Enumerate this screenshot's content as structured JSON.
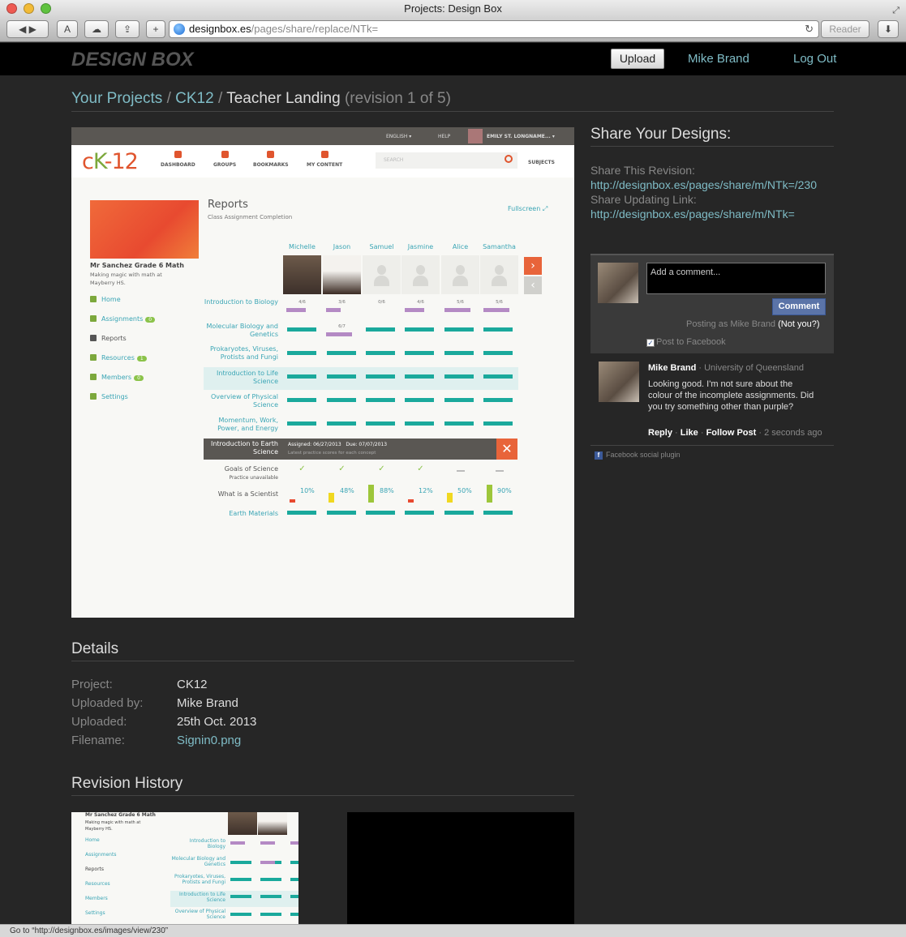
{
  "window": {
    "title": "Projects: Design Box"
  },
  "browser": {
    "url_host": "designbox.es",
    "url_path": "/pages/share/replace/NTk=",
    "reader_label": "Reader",
    "status_text": "Go to “http://designbox.es/images/view/230”"
  },
  "site": {
    "logo": "DESIGN BOX",
    "upload_label": "Upload",
    "user_name": "Mike Brand",
    "logout_label": "Log Out"
  },
  "breadcrumb": {
    "projects": "Your Projects",
    "sep": "/",
    "project": "CK12",
    "page": "Teacher Landing",
    "revision": "(revision 1 of 5)"
  },
  "preview": {
    "topbar": {
      "language": "ENGLISH ▾",
      "help": "HELP",
      "user": "EMILY ST. LONGNAME... ▾"
    },
    "logo_c": "c",
    "logo_k": "K",
    "logo_rest": "-12",
    "nav": [
      "DASHBOARD",
      "GROUPS",
      "BOOKMARKS",
      "MY CONTENT"
    ],
    "search_placeholder": "SEARCH",
    "subjects": "SUBJECTS",
    "class_name": "Mr Sanchez Grade 6 Math",
    "class_sub": "Making magic with math at Mayberry HS.",
    "sidebar": [
      {
        "label": "Home",
        "badge": ""
      },
      {
        "label": "Assignments",
        "badge": "0"
      },
      {
        "label": "Reports",
        "badge": ""
      },
      {
        "label": "Resources",
        "badge": "1"
      },
      {
        "label": "Members",
        "badge": "0"
      },
      {
        "label": "Settings",
        "badge": ""
      }
    ],
    "report_title": "Reports",
    "report_sub": "Class Assignment Completion",
    "fullscreen": "Fullscreen",
    "students": [
      "Michelle",
      "Jason",
      "Samuel",
      "Jasmine",
      "Alice",
      "Samantha"
    ],
    "rows": [
      {
        "label": "Introduction to Biology",
        "fractions": [
          "4/6",
          "3/6",
          "0/6",
          "4/6",
          "5/6",
          "5/6"
        ]
      },
      {
        "label": "Molecular Biology and Genetics",
        "fractions": [
          "",
          "6/7",
          "",
          "",
          "",
          ""
        ]
      },
      {
        "label": "Prokaryotes, Viruses, Protists and Fungi"
      },
      {
        "label": "Introduction to Life Science"
      },
      {
        "label": "Overview of Physical Science"
      },
      {
        "label": "Momentum, Work, Power, and Energy"
      },
      {
        "label": "Introduction to Earth Science"
      }
    ],
    "selected": {
      "assigned": "Assigned: 06/27/2013",
      "due": "Due: 07/07/2013",
      "note": "Latest practice scores for each concept"
    },
    "sub_rows": {
      "goals": "Goals of Science",
      "goals_note": "Practice unavailable",
      "scientist": "What is a Scientist",
      "percents": [
        "10%",
        "48%",
        "88%",
        "12%",
        "50%",
        "90%"
      ],
      "earth": "Earth Materials"
    }
  },
  "share": {
    "title": "Share Your Designs:",
    "revision_label": "Share This Revision:",
    "revision_url": "http://designbox.es/pages/share/m/NTk=/230",
    "updating_label": "Share Updating Link:",
    "updating_url": "http://designbox.es/pages/share/m/NTk="
  },
  "facebook": {
    "placeholder": "Add a comment...",
    "comment_button": "Comment",
    "posting_as": "Posting as Mike Brand",
    "not_you": "(Not you?)",
    "post_to_fb": "Post to Facebook",
    "post": {
      "author": "Mike Brand",
      "affiliation": "· University of Queensland",
      "body": "Looking good. I'm not sure about the colour of the incomplete assignments. Did you try something other than purple?",
      "reply": "Reply",
      "like": "Like",
      "follow": "Follow Post",
      "time": "· 2 seconds ago"
    },
    "plugin": "Facebook social plugin"
  },
  "details": {
    "title": "Details",
    "project_label": "Project:",
    "project": "CK12",
    "uploaded_by_label": "Uploaded by:",
    "uploaded_by": "Mike Brand",
    "uploaded_label": "Uploaded:",
    "uploaded": "25th Oct. 2013",
    "filename_label": "Filename:",
    "filename": "Signin0.png"
  },
  "revision_history": {
    "title": "Revision History"
  },
  "colors": {
    "accent": "#7fbcc6",
    "bg": "#262626",
    "ck_teal": "#1aa99c",
    "ck_orange": "#e8643a",
    "ck_purple": "#b48ac4"
  }
}
